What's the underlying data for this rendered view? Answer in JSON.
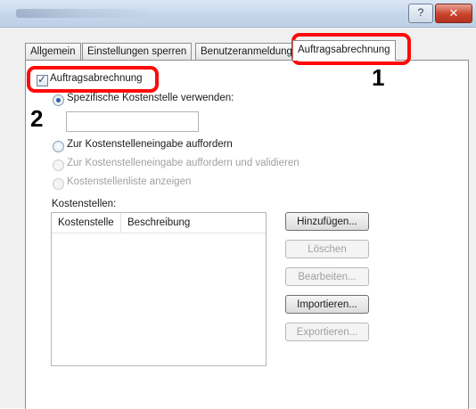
{
  "window": {
    "help_glyph": "?",
    "close_glyph": "✕"
  },
  "tabs": [
    {
      "label": "Allgemein"
    },
    {
      "label": "Einstellungen sperren"
    },
    {
      "label": "Benutzeranmeldung"
    },
    {
      "label": "Auftragsabrechnung"
    }
  ],
  "job_accounting": {
    "checkbox_label": "Auftragsabrechnung",
    "checked": true,
    "use_specific_label": "Spezifische Kostenstelle verwenden:",
    "cost_center_value": "",
    "prompt_label": "Zur Kostenstelleneingabe auffordern",
    "prompt_validate_label": "Zur Kostenstelleneingabe auffordern und validieren",
    "show_list_label": "Kostenstellenliste anzeigen",
    "list_title": "Kostenstellen:",
    "columns": [
      "Kostenstelle",
      "Beschreibung"
    ],
    "rows": []
  },
  "buttons": {
    "add": "Hinzufügen...",
    "delete": "Löschen",
    "edit": "Bearbeiten...",
    "import": "Importieren...",
    "export": "Exportieren..."
  },
  "annotations": {
    "step1": "1",
    "step2": "2",
    "highlight_color": "#ff0a0a"
  }
}
